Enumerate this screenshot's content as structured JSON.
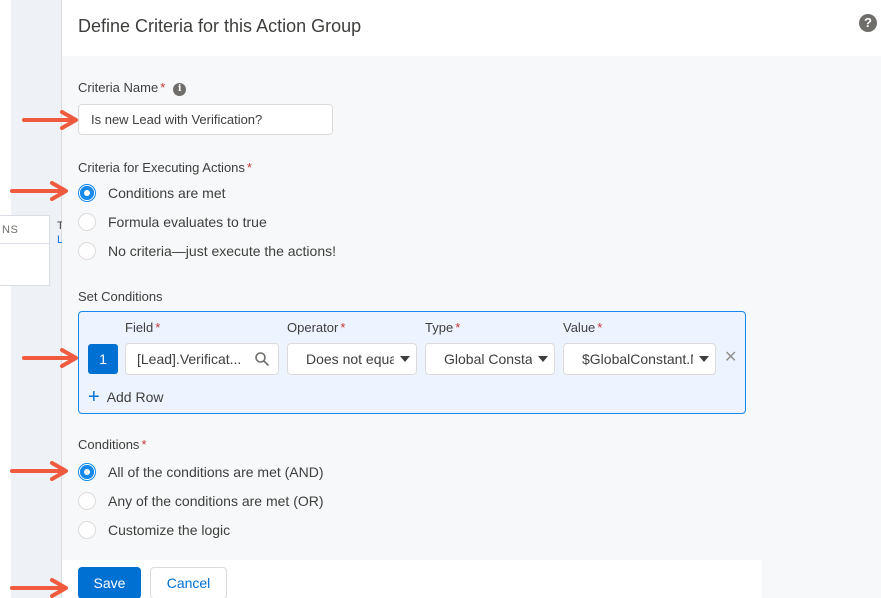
{
  "page": {
    "title": "Define Criteria for this Action Group",
    "help_icon": "question-icon"
  },
  "background": {
    "table_header": "NS",
    "side_text_1": "T",
    "side_text_2": "L"
  },
  "criteria_name": {
    "label": "Criteria Name",
    "required_mark": "*",
    "info_icon": "info-icon",
    "value": "Is new Lead with Verification?"
  },
  "criteria_execution": {
    "label": "Criteria for Executing Actions",
    "required_mark": "*",
    "options": [
      {
        "label": "Conditions are met",
        "selected": true
      },
      {
        "label": "Formula evaluates to true",
        "selected": false
      },
      {
        "label": "No criteria—just execute the actions!",
        "selected": false
      }
    ]
  },
  "set_conditions": {
    "label": "Set Conditions",
    "columns": {
      "field": "Field",
      "operator": "Operator",
      "type": "Type",
      "value": "Value"
    },
    "required_mark": "*",
    "rows": [
      {
        "number": "1",
        "field": "[Lead].Verificat...",
        "operator": "Does not equal",
        "type": "Global Constant",
        "value": "$GlobalConstant.Null"
      }
    ],
    "add_row_label": "Add Row",
    "remove_icon": "close-icon"
  },
  "conditions": {
    "label": "Conditions",
    "required_mark": "*",
    "options": [
      {
        "label": "All of the conditions are met (AND)",
        "selected": true
      },
      {
        "label": "Any of the conditions are met (OR)",
        "selected": false
      },
      {
        "label": "Customize the logic",
        "selected": false
      }
    ]
  },
  "footer": {
    "save_label": "Save",
    "cancel_label": "Cancel"
  },
  "colors": {
    "brand": "#0070d2",
    "radio_selected": "#1589ee",
    "required": "#c23934",
    "annotation_arrow": "#f05a3e"
  }
}
